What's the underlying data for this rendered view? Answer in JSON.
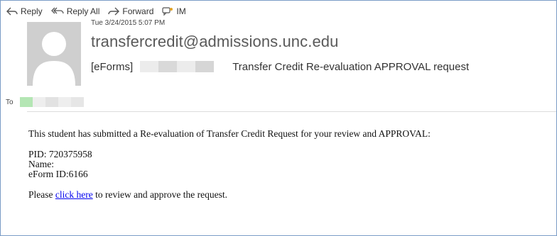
{
  "toolbar": {
    "reply_label": "Reply",
    "reply_all_label": "Reply All",
    "forward_label": "Forward",
    "im_label": "IM"
  },
  "header": {
    "sent": "Tue 3/24/2015 5:07 PM",
    "sender": "transfercredit@admissions.unc.edu",
    "subject_prefix": "[eForms]",
    "subject_rest": "Transfer Credit Re-evaluation APPROVAL request",
    "to_label": "To"
  },
  "body": {
    "intro": "This student has submitted a Re-evaluation of Transfer Credit Request for your review and APPROVAL:",
    "pid": "PID: 720375958",
    "name": "Name:",
    "eform_id": "eForm ID:6166",
    "action_prefix": "Please ",
    "action_link": "click here",
    "action_suffix": " to review and approve the request."
  },
  "colors": {
    "frame_border": "#7a9cc6",
    "link": "#0000ee",
    "avatar_bg": "#cfcfcf"
  }
}
